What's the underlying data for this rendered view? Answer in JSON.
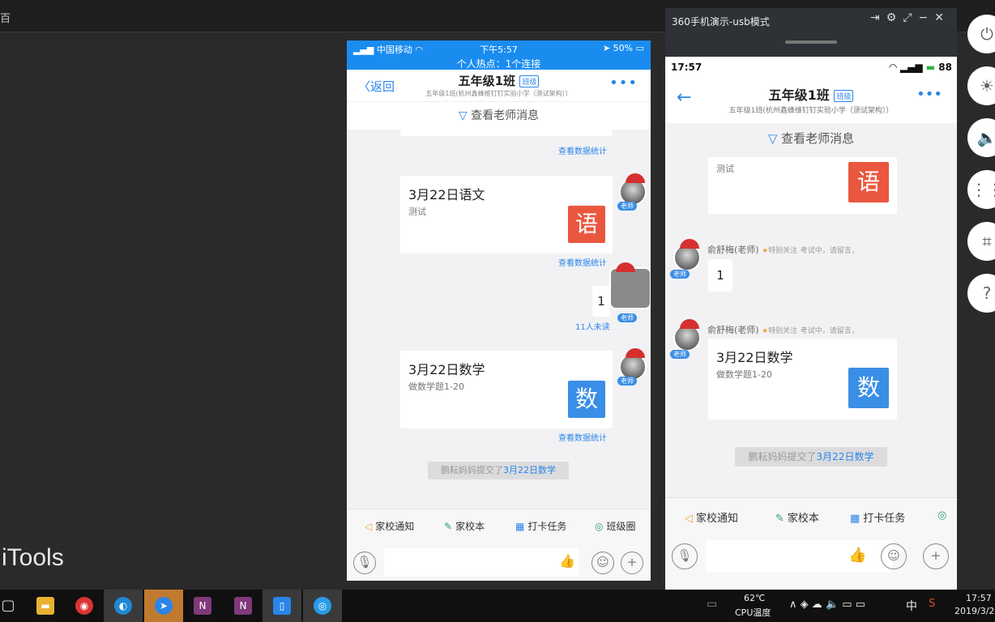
{
  "desktop": {
    "edge_char": "百",
    "itools_label": "iTools"
  },
  "iphone": {
    "status": {
      "carrier": "中国移动",
      "time": "下午5:57",
      "battery": "50%",
      "hotspot": "个人热点：1个连接"
    },
    "nav": {
      "back_label": "返回",
      "title": "五年级1班",
      "badge": "班级",
      "subtitle": "五年级1班(杭州鑫蜂维钉钉实验小学（测试架构））"
    },
    "filter_label": "查看老师消息",
    "stats_link": "查看数据统计",
    "messages": [
      {
        "title": "3月22日语文",
        "desc": "测试",
        "subject": "语"
      },
      {
        "title": "3月22日数学",
        "desc": "做数学题1-20",
        "subject": "数"
      }
    ],
    "teacher_tag": "老师",
    "bubble_text": "1",
    "unread": "11人未读",
    "system_msg": {
      "prefix": "鹏耘妈妈提交了",
      "link": "3月22日数学"
    },
    "toolbar": [
      "家校通知",
      "家校本",
      "打卡任务",
      "班级圈"
    ]
  },
  "android": {
    "window_title": "360手机演示-usb模式",
    "status": {
      "time": "17:57",
      "battery": "88"
    },
    "nav": {
      "title": "五年级1班",
      "badge": "班级",
      "subtitle": "五年级1班(杭州鑫蜂维钉钉实验小学（测试架构））"
    },
    "filter_label": "查看老师消息",
    "partial_card_desc": "测试",
    "partial_card_subject": "语",
    "sender": {
      "name": "俞舒梅(老师)",
      "special": "特别关注",
      "status": "考试中，请留言，"
    },
    "teacher_tag": "老师",
    "bubble_text": "1",
    "math_card": {
      "title": "3月22日数学",
      "desc": "做数学题1-20",
      "subject": "数"
    },
    "system_msg": {
      "prefix": "鹏耘妈妈提交了",
      "link": "3月22日数学"
    },
    "toolbar": [
      "家校通知",
      "家校本",
      "打卡任务"
    ]
  },
  "taskbar": {
    "cpu_temp": "62℃",
    "cpu_label": "CPU温度",
    "ime": "中",
    "clock_time": "17:57",
    "clock_date": "2019/3/2"
  },
  "colors": {
    "accent": "#2a85e8",
    "status_bar": "#1a8cf0",
    "chinese_tile": "#e9573f",
    "math_tile": "#3a8ee6"
  }
}
